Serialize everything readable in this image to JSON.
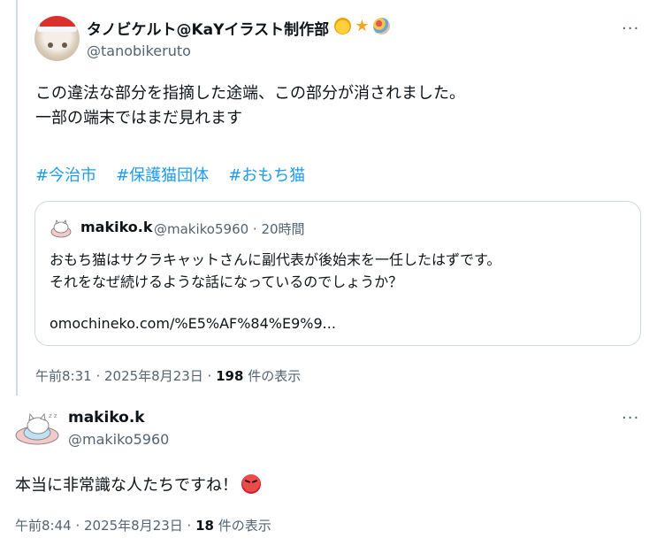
{
  "tweet1": {
    "display_name": "タノビケルト@KaYイラスト制作部",
    "badge_icons": [
      "smiley-badge-icon",
      "star-badge-icon",
      "palette-badge-icon"
    ],
    "handle": "@tanobikeruto",
    "more": "···",
    "text_line1": "この違法な部分を指摘した途端、この部分が消されました。",
    "text_line2": "一部の端末ではまだ見れます",
    "hashtags": [
      "#今治市",
      "#保護猫団体",
      "#おもち猫"
    ],
    "quote": {
      "display_name": "makiko.k",
      "handle_time": "@makiko5960 · 20時間",
      "text_line1": "おもち猫はサクラキャットさんに副代表が後始末を一任したはずです。",
      "text_line2": "それをなぜ続けるような話になっているのでしょうか？",
      "link": "omochineko.com/%E5%AF%84%E9%9..."
    },
    "timestamp": "午前8:31 · 2025年8月23日 · ",
    "views_count": "198",
    "views_label": " 件の表示"
  },
  "tweet2": {
    "display_name": "makiko.k",
    "handle": "@makiko5960",
    "more": "···",
    "text": "本当に非常識な人たちですね！",
    "emoji_icon": "angry-face-icon",
    "timestamp": "午前8:44 · 2025年8月23日 · ",
    "views_count": "18",
    "views_label": " 件の表示"
  },
  "colors": {
    "link": "#1d9bf0",
    "secondary_text": "#536471",
    "border": "#cfd9de"
  }
}
